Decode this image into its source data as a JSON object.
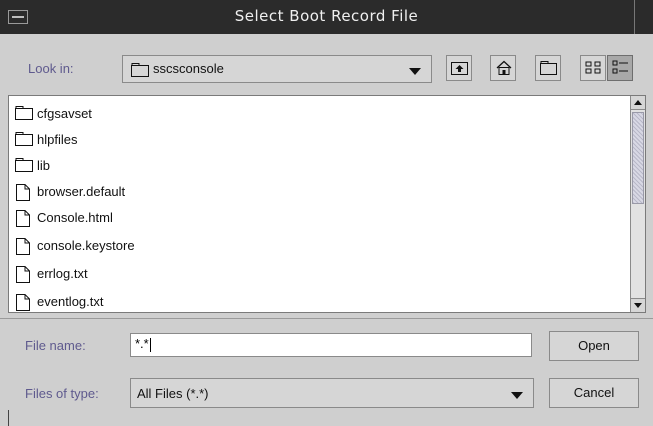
{
  "window": {
    "title": "Select Boot Record File"
  },
  "look_in": {
    "label": "Look in:",
    "selected": "sscsconsole"
  },
  "toolbar": {
    "icons": [
      "up-one-level-icon",
      "home-icon",
      "new-folder-icon",
      "list-view-icon",
      "details-view-icon"
    ]
  },
  "files": [
    {
      "name": "cfgsavset",
      "type": "folder"
    },
    {
      "name": "hlpfiles",
      "type": "folder"
    },
    {
      "name": "lib",
      "type": "folder"
    },
    {
      "name": "browser.default",
      "type": "file"
    },
    {
      "name": "Console.html",
      "type": "file"
    },
    {
      "name": "console.keystore",
      "type": "file"
    },
    {
      "name": "errlog.txt",
      "type": "file"
    },
    {
      "name": "eventlog.txt",
      "type": "file"
    }
  ],
  "file_name": {
    "label": "File name:",
    "value": "*.*"
  },
  "files_of_type": {
    "label": "Files of type:",
    "selected": "All Files (*.*)"
  },
  "buttons": {
    "open": "Open",
    "cancel": "Cancel"
  }
}
